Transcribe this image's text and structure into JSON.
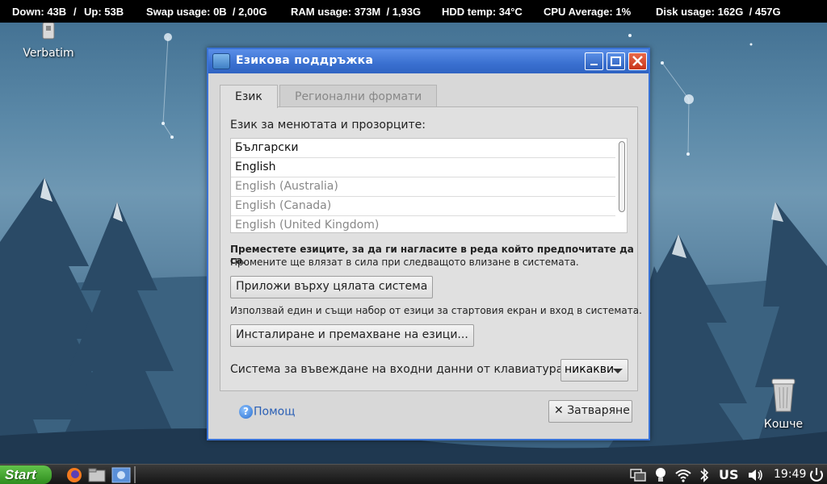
{
  "conky": {
    "down": "Down: 43B",
    "up": "Up: 53B",
    "swap": "Swap usage: 0B  / 2,00G",
    "ram": "RAM usage: 373M  / 1,93G",
    "hdd": "HDD temp: 34°C",
    "cpu": "CPU Average: 1%",
    "disk": "Disk usage: 162G  / 457G",
    "sep": "/"
  },
  "desktop": {
    "usb_label": "Verbatim",
    "trash_label": "Кошче"
  },
  "window": {
    "title": "Езикова поддръжка",
    "tabs": [
      "Език",
      "Регионални формати"
    ],
    "menu_language_label": "Език за менютата и прозорците:",
    "languages": [
      {
        "name": "Български",
        "enabled": true
      },
      {
        "name": "English",
        "enabled": true
      },
      {
        "name": "English (Australia)",
        "enabled": false
      },
      {
        "name": "English (Canada)",
        "enabled": false
      },
      {
        "name": "English (United Kingdom)",
        "enabled": false
      }
    ],
    "drag_hint": "Преместете езиците, за да ги нагласите в реда който предпочитате да са.",
    "effect_hint": "Промените ще влязат в сила при следващото влизане в системата.",
    "apply_button": "Приложи върху цялата система",
    "same_set_hint": "Използвай един и същи набор от езици за стартовия екран и вход в системата.",
    "install_button": "Инсталиране и премахване на езици...",
    "input_method_label": "Система за въвеждане на входни данни от клавиатурата:",
    "input_method_value": "никакви",
    "help_label": "Помощ",
    "close_label": "Затваряне"
  },
  "taskbar": {
    "start_label": "Start",
    "keyboard_layout": "US",
    "clock": "19:49"
  },
  "colors": {
    "titlebar": "#3a70d0",
    "start": "#3fa82e",
    "conky_bg": "#000000"
  }
}
